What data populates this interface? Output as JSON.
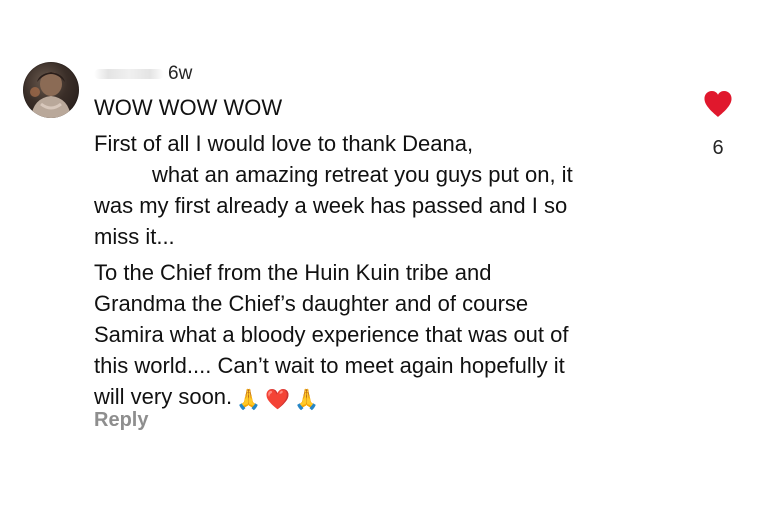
{
  "comment": {
    "timestamp": "6w",
    "title": "WOW WOW WOW",
    "paragraph1": [
      "First of all I would love to thank Deana,",
      "what an amazing retreat you guys put on, it",
      "was my first already a week has passed and I so",
      "miss it..."
    ],
    "paragraph2": [
      "To the Chief from the Huin Kuin tribe and",
      "Grandma the Chief’s daughter and of course",
      "Samira what a bloody experience that was out of",
      "this world.... Can’t wait to meet again hopefully it",
      "will very soon."
    ],
    "emojis": [
      "🙏",
      "❤️",
      "🙏"
    ],
    "reply_label": "Reply"
  },
  "likes": {
    "count": "6",
    "liked": true,
    "heart_color": "#e0182d"
  },
  "icons": {
    "avatar": "avatar",
    "like": "heart-icon"
  }
}
